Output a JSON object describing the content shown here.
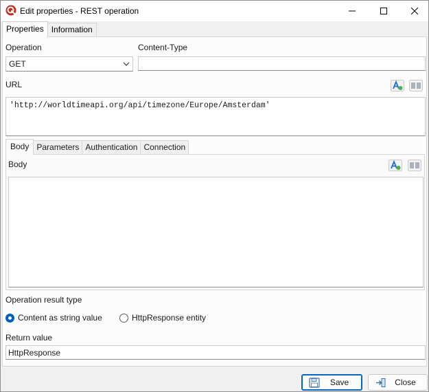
{
  "window": {
    "title": "Edit properties - REST operation",
    "controls": {
      "minimize": "minimize-icon",
      "maximize": "maximize-icon",
      "close": "close-icon"
    }
  },
  "tabs": [
    {
      "label": "Properties",
      "active": true
    },
    {
      "label": "Information",
      "active": false
    }
  ],
  "operation": {
    "label": "Operation",
    "value": "GET"
  },
  "content_type": {
    "label": "Content-Type",
    "value": ""
  },
  "url": {
    "label": "URL",
    "value": "'http://worldtimeapi.org/api/timezone/Europe/Amsterdam'"
  },
  "inner_tabs": [
    {
      "label": "Body",
      "active": true
    },
    {
      "label": "Parameters",
      "active": false
    },
    {
      "label": "Authentication",
      "active": false
    },
    {
      "label": "Connection",
      "active": false
    }
  ],
  "body": {
    "label": "Body",
    "value": ""
  },
  "result_type": {
    "label": "Operation result type",
    "options": [
      {
        "label": "Content as string value",
        "selected": true
      },
      {
        "label": "HttpResponse entity",
        "selected": false
      }
    ]
  },
  "return_value": {
    "label": "Return value",
    "value": "HttpResponse"
  },
  "buttons": {
    "save": "Save",
    "close": "Close"
  },
  "colors": {
    "accent": "#0067c0",
    "radio_selected": "#0060c0",
    "app_icon": "#c42b1c"
  }
}
